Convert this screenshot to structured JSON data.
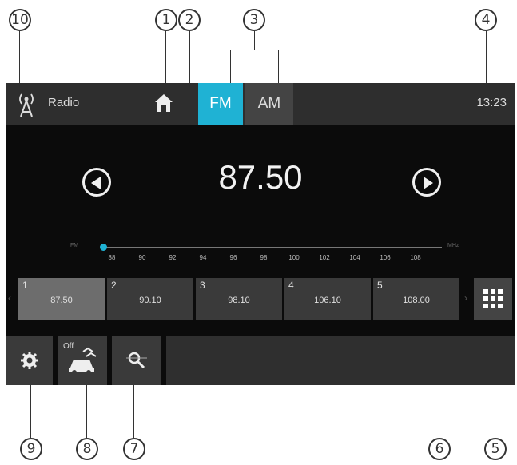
{
  "callouts": [
    "10",
    "1",
    "2",
    "3",
    "4",
    "9",
    "8",
    "7",
    "6",
    "5"
  ],
  "topbar": {
    "source_label": "Radio",
    "tab_fm": "FM",
    "tab_am": "AM",
    "clock": "13:23"
  },
  "tuner": {
    "frequency": "87.50",
    "scale_min_label": "FM",
    "scale_max_label": "MHz",
    "ticks": [
      "88",
      "90",
      "92",
      "94",
      "96",
      "98",
      "100",
      "102",
      "104",
      "106",
      "108"
    ]
  },
  "presets": [
    {
      "num": "1",
      "freq": "87.50"
    },
    {
      "num": "2",
      "freq": "90.10"
    },
    {
      "num": "3",
      "freq": "98.10"
    },
    {
      "num": "4",
      "freq": "106.10"
    },
    {
      "num": "5",
      "freq": "108.00"
    }
  ],
  "bottombar": {
    "traffic_off_label": "Off"
  },
  "colors": {
    "accent": "#1fb2d4",
    "screen_bg": "#0b0b0b",
    "bar_bg": "#2e2e2e"
  },
  "icons": [
    "antenna-icon",
    "home-icon",
    "seek-previous-icon",
    "seek-next-icon",
    "grid-icon",
    "settings-icon",
    "traffic-icon",
    "search-icon"
  ]
}
